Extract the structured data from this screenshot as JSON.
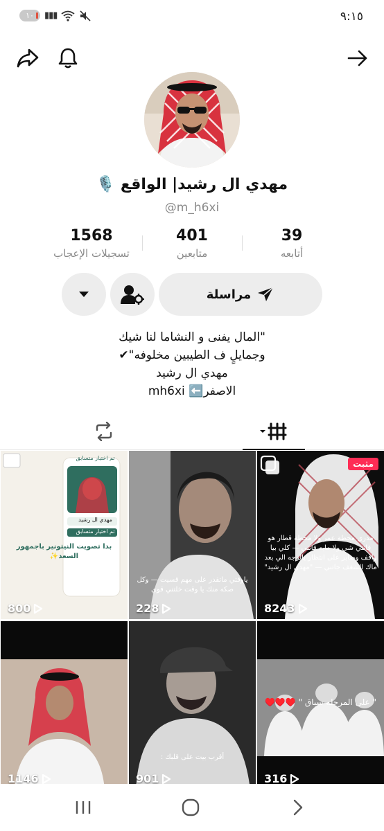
{
  "status_bar": {
    "time": "٩:١٥",
    "battery": "١٠",
    "icons": [
      "battery-icon",
      "signal-icon",
      "wifi-icon",
      "mute-icon"
    ]
  },
  "top_nav": {
    "icons": [
      "share-icon",
      "bell-icon",
      "back-arrow-icon"
    ]
  },
  "profile": {
    "display_name": "مهدي ال رشيد| الواقع 🎙️",
    "handle": "@m_h6xi",
    "stats": [
      {
        "value": "1568",
        "label": "تسجيلات الإعجاب"
      },
      {
        "value": "401",
        "label": "متابعين"
      },
      {
        "value": "39",
        "label": "أتابعه"
      }
    ],
    "message_label": "مراسلة",
    "bio_lines": [
      "\"المال يفنى و النشاما لنا شيك",
      "وجمايلٍ ف الطيبين مخلوفه\"✔",
      "مهدي ال رشيد",
      "الاصفر⬅️ mh6xi"
    ]
  },
  "tabs": [
    {
      "name": "videos",
      "icon": "grid-icon",
      "active": true
    },
    {
      "name": "reposts",
      "icon": "repost-icon",
      "active": false
    }
  ],
  "videos": [
    {
      "views": "8243",
      "pinned_label": "مثبت",
      "caption": "مدري محطة عمر ولا محطة قطار هو فاتني شي ولا مابه فاتني — كلي بيا واقف وصابر على انتظار يالرجه الي بعد ماك الشغف جاتني — \"مهدي ال رشيد\""
    },
    {
      "views": "228",
      "caption": "ياوقتي ماتقدر على مهم قسيت — وكل صكه منك يا وقت خلتني قوي"
    },
    {
      "views": "800",
      "caption": "بدا تصويت النيتونير باجمهور السعد✨",
      "card_top": "تم اختيار متسابق",
      "card_name": "مهدي ال رشيد",
      "card_bottom": "تم اختيار متسابق"
    },
    {
      "views": "316",
      "caption": "\" على المرجله سباق \" ♥️♥️♥️"
    },
    {
      "views": "901",
      "caption": "أقرب بيت على قلبك :"
    },
    {
      "views": "1146",
      "caption": ""
    }
  ],
  "colors": {
    "accent": "#fe2c55",
    "button_bg": "#ededed",
    "muted_text": "#8a8a8a"
  }
}
